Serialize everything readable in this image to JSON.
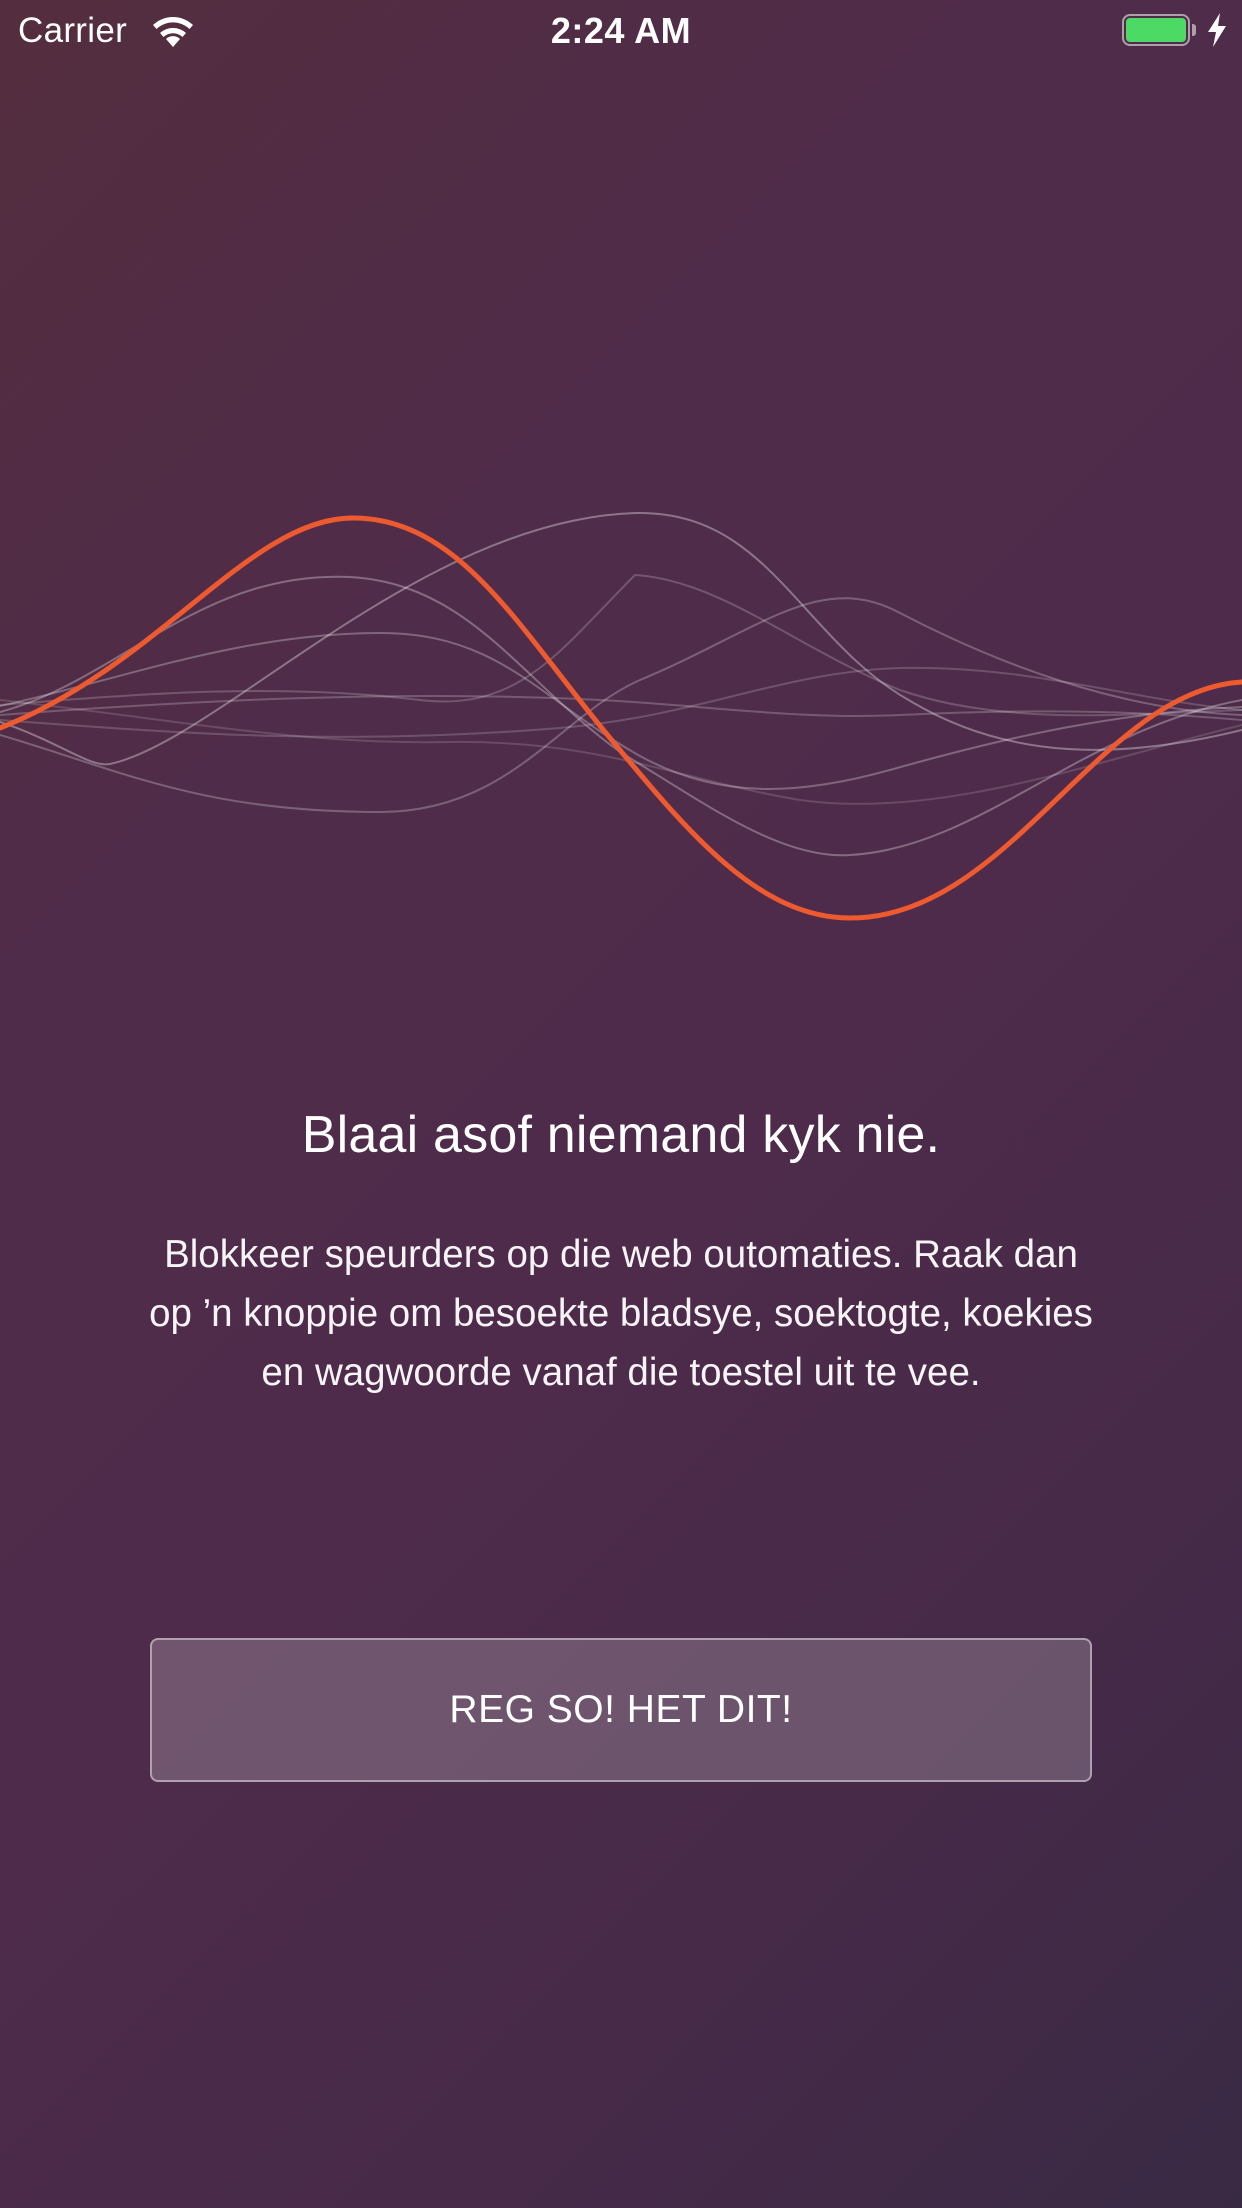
{
  "status_bar": {
    "carrier": "Carrier",
    "time": "2:24 AM",
    "battery_color": "#4cd964"
  },
  "icons": {
    "wifi": "wifi-icon",
    "battery": "battery-icon",
    "charging": "charging-bolt-icon"
  },
  "illustration": {
    "name": "sound-wave-illustration",
    "accent_color": "#ee5a2f"
  },
  "content": {
    "headline": "Blaai asof niemand kyk nie.",
    "description": "Blokkeer speurders op die web outomaties. Raak dan op ’n knoppie om besoekte bladsye, soektogte, koekies en wagwoorde vanaf die toestel uit te vee."
  },
  "actions": {
    "primary_label": "REG SO! HET DIT!"
  }
}
